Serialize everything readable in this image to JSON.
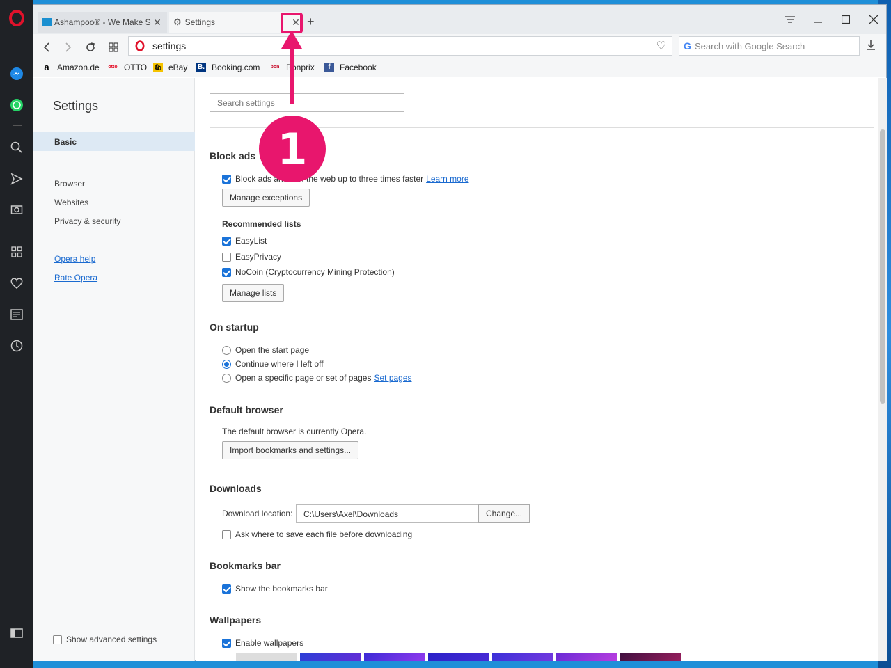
{
  "tabs": [
    {
      "label": "Ashampoo® - We Make S"
    },
    {
      "label": "Settings"
    }
  ],
  "address": {
    "value": "settings"
  },
  "search": {
    "placeholder": "Search with Google Search"
  },
  "bookmarks": [
    "Amazon.de",
    "OTTO",
    "eBay",
    "Booking.com",
    "Bonprix",
    "Facebook"
  ],
  "nav": {
    "title": "Settings",
    "basic": "Basic",
    "items": [
      "Browser",
      "Websites",
      "Privacy & security"
    ],
    "links": [
      "Opera help",
      "Rate Opera"
    ],
    "advanced": "Show advanced settings"
  },
  "settings": {
    "search_placeholder": "Search settings",
    "block_ads": {
      "heading": "Block ads",
      "toggle": "Block ads and surf the web up to three times faster",
      "learn_more": "Learn more",
      "manage_exceptions": "Manage exceptions",
      "recommended": "Recommended lists",
      "lists": [
        "EasyList",
        "EasyPrivacy",
        "NoCoin (Cryptocurrency Mining Protection)"
      ],
      "manage_lists": "Manage lists"
    },
    "startup": {
      "heading": "On startup",
      "options": [
        "Open the start page",
        "Continue where I left off",
        "Open a specific page or set of pages"
      ],
      "set_pages": "Set pages"
    },
    "default_browser": {
      "heading": "Default browser",
      "status": "The default browser is currently Opera.",
      "import": "Import bookmarks and settings..."
    },
    "downloads": {
      "heading": "Downloads",
      "location_label": "Download location:",
      "location": "C:\\Users\\Axel\\Downloads",
      "change": "Change...",
      "ask": "Ask where to save each file before downloading"
    },
    "bookmarks_bar": {
      "heading": "Bookmarks bar",
      "show": "Show the bookmarks bar"
    },
    "wallpapers": {
      "heading": "Wallpapers",
      "enable": "Enable wallpapers"
    }
  },
  "annotation": {
    "step": "1"
  },
  "colors": {
    "accent": "#1a73d9",
    "annotation": "#e8166d",
    "opera_red": "#e0122b"
  }
}
